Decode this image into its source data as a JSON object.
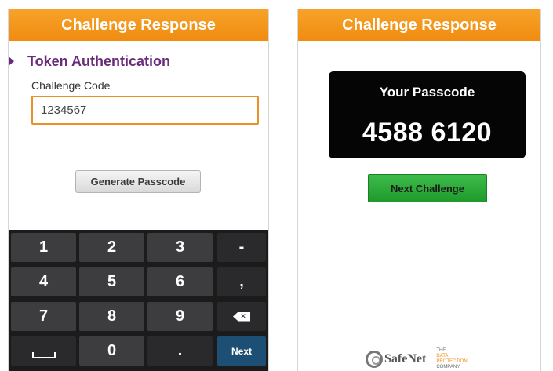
{
  "left_screen": {
    "title": "Challenge Response",
    "section_title": "Token Authentication",
    "field_label": "Challenge Code",
    "field_value": "1234567",
    "generate_button": "Generate Passcode",
    "keypad": {
      "row1": [
        "1",
        "2",
        "3",
        "-"
      ],
      "row2": [
        "4",
        "5",
        "6",
        ","
      ],
      "row3": [
        "7",
        "8",
        "9"
      ],
      "row4": [
        "0",
        "."
      ],
      "next_label": "Next"
    }
  },
  "right_screen": {
    "title": "Challenge Response",
    "passcode_label": "Your Passcode",
    "passcode_value": "4588 6120",
    "next_challenge_button": "Next Challenge",
    "logo": {
      "word": "SafeNet",
      "tag_line1": "THE",
      "tag_line2": "DATA",
      "tag_line3": "PROTECTION",
      "tag_line4": "COMPANY"
    }
  },
  "colors": {
    "title_bar": "#f08c10",
    "section_title": "#6a2c7a",
    "input_border": "#e9902a",
    "next_key": "#1c4f73",
    "next_challenge": "#1f9a2c"
  }
}
